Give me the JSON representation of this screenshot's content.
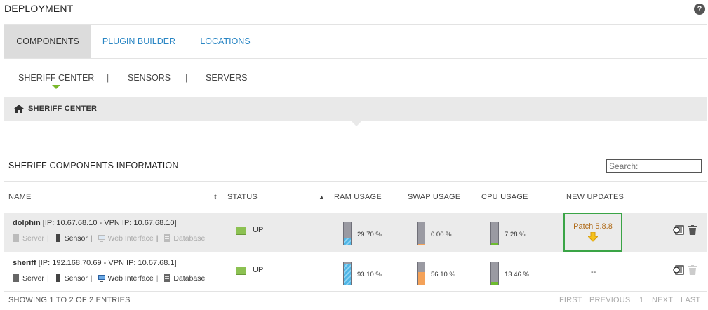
{
  "header": {
    "title": "DEPLOYMENT",
    "help": "?"
  },
  "tabs": [
    {
      "label": "COMPONENTS"
    },
    {
      "label": "PLUGIN BUILDER"
    },
    {
      "label": "LOCATIONS"
    }
  ],
  "subnav": {
    "items": [
      "SHERIFF CENTER",
      "SENSORS",
      "SERVERS"
    ],
    "separator": "|"
  },
  "breadcrumb": {
    "label": "SHERIFF CENTER"
  },
  "section": {
    "title": "SHERIFF COMPONENTS INFORMATION",
    "search_placeholder": "Search:"
  },
  "table": {
    "columns": [
      "NAME",
      "STATUS",
      "RAM USAGE",
      "SWAP USAGE",
      "CPU USAGE",
      "NEW UPDATES"
    ],
    "rows": [
      {
        "name": "dolphin",
        "ips": "[IP: 10.67.68.10 - VPN IP: 10.67.68.10]",
        "services": [
          "Server",
          "Sensor",
          "Web Interface",
          "Database"
        ],
        "status": "UP",
        "ram": "29.70 %",
        "ram_pct": 29.7,
        "swap": "0.00 %",
        "swap_pct": 0.0,
        "cpu": "7.28 %",
        "cpu_pct": 7.28,
        "update": "Patch 5.8.8"
      },
      {
        "name": "sheriff",
        "ips": "[IP: 192.168.70.69 - VPN IP: 10.67.68.1]",
        "services": [
          "Server",
          "Sensor",
          "Web Interface",
          "Database"
        ],
        "status": "UP",
        "ram": "93.10 %",
        "ram_pct": 93.1,
        "swap": "56.10 %",
        "swap_pct": 56.1,
        "cpu": "13.46 %",
        "cpu_pct": 13.46,
        "update": "--"
      }
    ]
  },
  "footer": {
    "entries": "SHOWING 1 TO 2 OF 2 ENTRIES",
    "pager": {
      "first": "FIRST",
      "previous": "PREVIOUS",
      "page": "1",
      "next": "NEXT",
      "last": "LAST"
    }
  },
  "colors": {
    "accent": "#7ab82b",
    "link": "#2a86c4",
    "status_up": "#8cc152",
    "update_border": "#3aa446",
    "ram": "#4fb6e6",
    "swap": "#f4a259",
    "cpu": "#6dbb2e"
  }
}
